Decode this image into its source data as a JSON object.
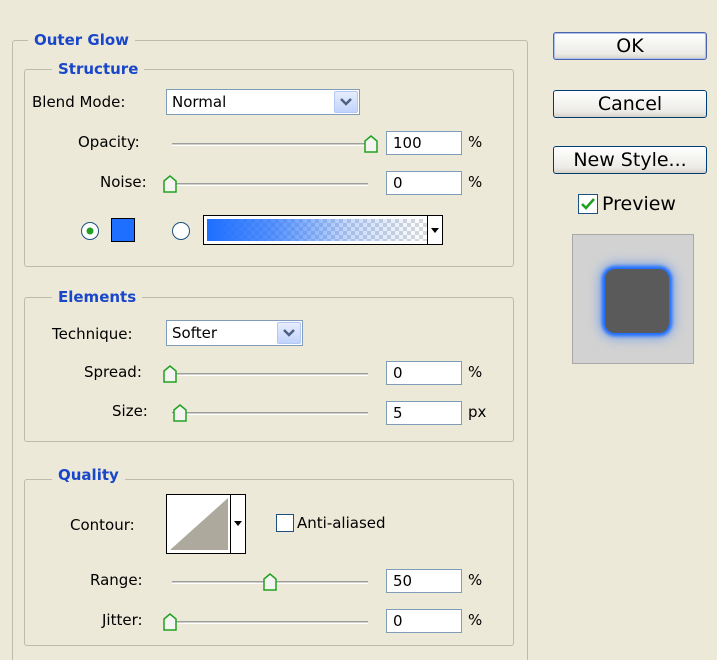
{
  "dialog": {
    "outer_glow_title": "Outer Glow",
    "structure": {
      "title": "Structure",
      "blend_mode_label": "Blend Mode:",
      "blend_mode_value": "Normal",
      "opacity_label": "Opacity:",
      "opacity_value": "100",
      "opacity_unit": "%",
      "opacity_level": 1.0,
      "noise_label": "Noise:",
      "noise_value": "0",
      "noise_unit": "%",
      "noise_level": 0.0,
      "solid_color": "#1E6FFF",
      "gradient_colors": [
        "#1E6FFF",
        "#FFFFFF"
      ]
    },
    "elements": {
      "title": "Elements",
      "technique_label": "Technique:",
      "technique_value": "Softer",
      "spread_label": "Spread:",
      "spread_value": "0",
      "spread_unit": "%",
      "spread_level": 0.0,
      "size_label": "Size:",
      "size_value": "5",
      "size_unit": "px",
      "size_level": 0.02
    },
    "quality": {
      "title": "Quality",
      "contour_label": "Contour:",
      "anti_aliased_label": "Anti-aliased",
      "anti_aliased_checked": false,
      "range_label": "Range:",
      "range_value": "50",
      "range_unit": "%",
      "range_level": 0.5,
      "jitter_label": "Jitter:",
      "jitter_value": "0",
      "jitter_unit": "%",
      "jitter_level": 0.0
    }
  },
  "side": {
    "ok_label": "OK",
    "cancel_label": "Cancel",
    "new_style_label": "New Style...",
    "preview_label": "Preview",
    "preview_checked": true
  },
  "colors": {
    "accent_title": "#1A47C9",
    "glow": "#1E6FFF",
    "preview_square": "#5A5A5A"
  }
}
